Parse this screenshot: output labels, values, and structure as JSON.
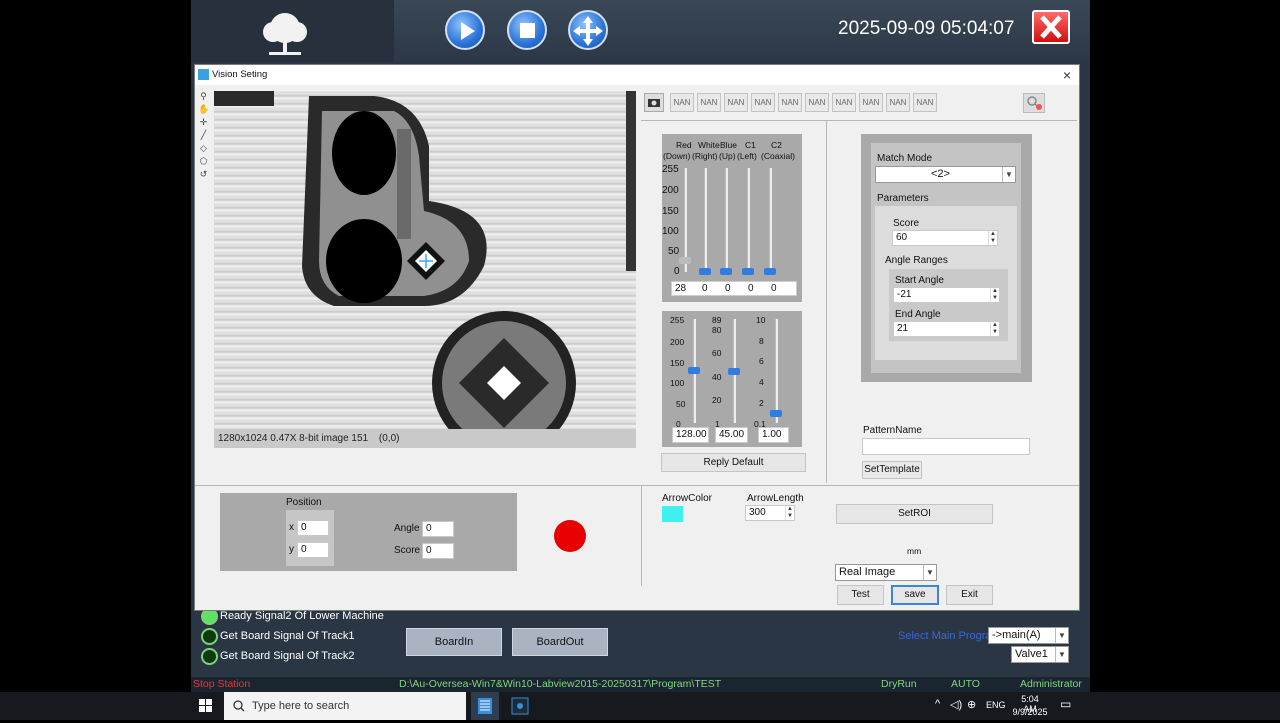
{
  "header": {
    "datetime": "2025-09-09 05:04:07"
  },
  "dialog": {
    "title": "Vision Seting",
    "close_glyph": "×",
    "image_status": "1280x1024 0.47X 8-bit image 151",
    "image_coords": "(0,0)",
    "nan_buttons": [
      "NAN",
      "NAN",
      "NAN",
      "NAN",
      "NAN",
      "NAN",
      "NAN",
      "NAN",
      "NAN",
      "NAN"
    ],
    "light": {
      "headers": [
        "Red",
        "White",
        "Blue",
        "C1",
        "C2"
      ],
      "subheaders": [
        "(Down)",
        "(Right)",
        "(Up)",
        "(Left)",
        "(Coaxial)"
      ],
      "scale": [
        "255",
        "200",
        "150",
        "100",
        "50",
        "0"
      ],
      "values": [
        "28",
        "0",
        "0",
        "0",
        "0"
      ]
    },
    "cam_params": {
      "scale1": [
        "255",
        "200",
        "150",
        "100",
        "50",
        "0"
      ],
      "scale2": [
        "89",
        "80",
        "60",
        "40",
        "20",
        "1"
      ],
      "scale3": [
        "10",
        "8",
        "6",
        "4",
        "2",
        "0.1"
      ],
      "values": [
        "128.00",
        "45.00",
        "1.00"
      ]
    },
    "reply_default": "Reply Default",
    "match": {
      "mode_label": "Match Mode",
      "mode_value": "<2>",
      "params_label": "Parameters",
      "score_label": "Score",
      "score_value": "60",
      "angle_ranges_label": "Angle Ranges",
      "start_angle_label": "Start Angle",
      "start_angle_value": "-21",
      "end_angle_label": "End Angle",
      "end_angle_value": "21"
    },
    "pattern_name_label": "PatternName",
    "pattern_name_value": "",
    "set_template": "SetTemplate",
    "position": {
      "label": "Position",
      "x_label": "x",
      "x_value": "0",
      "y_label": "y",
      "y_value": "0",
      "angle_label": "Angle",
      "angle_value": "0",
      "score_label": "Score",
      "score_value": "0"
    },
    "arrow_color_label": "ArrowColor",
    "arrow_color": "#3ff0f0",
    "arrow_length_label": "ArrowLength",
    "arrow_length_value": "300",
    "set_roi": "SetROI",
    "unit": "mm",
    "image_mode": "Real Image",
    "test": "Test",
    "save": "save",
    "exit": "Exit",
    "indicator_color": "#e80000"
  },
  "signals": [
    {
      "label": "Ready Signal2 Of  Lower Machine",
      "on": true
    },
    {
      "label": "Get Board Signal Of Track1",
      "on": false
    },
    {
      "label": "Get Board Signal Of Track2",
      "on": false
    }
  ],
  "board_in": "BoardIn",
  "board_out": "BoardOut",
  "select_program_label": "Select Main Program",
  "program_value": "->main(A)",
  "valve_value": "Valve1",
  "statusbar": {
    "left": "Stop Station",
    "path": "D:\\Au-Oversea-Win7&Win10-Labview2015-20250317\\Program\\TEST",
    "mode1": "DryRun",
    "mode2": "AUTO",
    "user": "Administrator"
  },
  "taskbar": {
    "search_placeholder": "Type here to search",
    "lang": "ENG",
    "time": "5:04 AM",
    "date": "9/9/2025"
  }
}
